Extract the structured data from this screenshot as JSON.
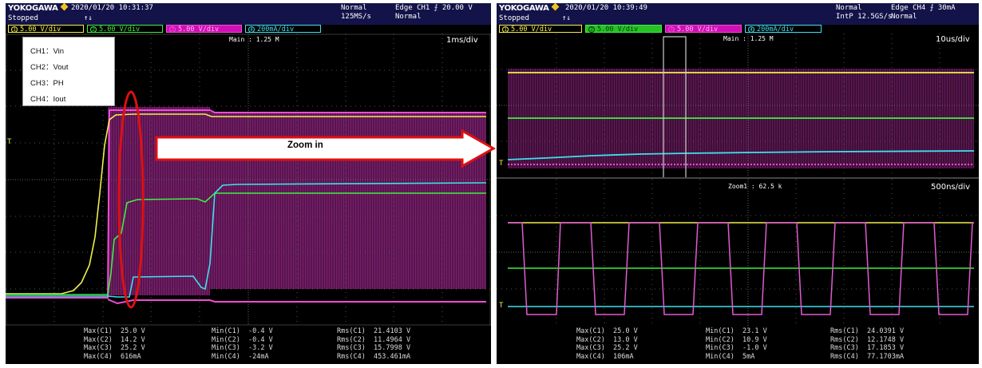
{
  "left": {
    "brand": "YOKOGAWA",
    "datetime": "2020/01/20 10:31:37",
    "status": "Stopped",
    "trigger_status_marker": "↑↓",
    "acq_mode": "Normal",
    "sample_rate": "125MS/s",
    "trigger_type": "Edge CH1 ⨍ 20.00 V",
    "trigger_mode": "Normal",
    "channels": [
      {
        "num": "1",
        "scale": "5.00 V/div"
      },
      {
        "num": "2",
        "scale": "5.00 V/div"
      },
      {
        "num": "3",
        "scale": "5.00 V/div"
      },
      {
        "num": "4",
        "scale": "200mA/div"
      }
    ],
    "main_label": "Main : 1.25 M",
    "timebase": "1ms/div",
    "legend": [
      "CH1：Vin",
      "CH2：Vout",
      "CH3：PH",
      "CH4：Iout"
    ],
    "measurements": {
      "max": "Max(C1)  25.0 V\nMax(C2)  14.2 V\nMax(C3)  25.2 V\nMax(C4)  616mA",
      "min": "Min(C1)  -0.4 V\nMin(C2)  -0.4 V\nMin(C3)  -3.2 V\nMin(C4)  -24mA",
      "rms": "Rms(C1)  21.4103 V\nRms(C2)  11.4964 V\nRms(C3)  15.7998 V\nRms(C4)  453.461mA"
    }
  },
  "right": {
    "brand": "YOKOGAWA",
    "datetime": "2020/01/20 10:39:49",
    "status": "Stopped",
    "trigger_status_marker": "↑↓",
    "acq_mode": "Normal",
    "sample_rate": "IntP 12.5GS/s",
    "trigger_type": "Edge CH4 ⨍ 30mA",
    "trigger_mode": "Normal",
    "channels": [
      {
        "num": "1",
        "scale": "5.00 V/div"
      },
      {
        "num": "2",
        "scale": "5.00 V/div"
      },
      {
        "num": "3",
        "scale": "5.00 V/div"
      },
      {
        "num": "4",
        "scale": "200mA/div"
      }
    ],
    "main_label": "Main : 1.25 M",
    "timebase_top": "10us/div",
    "zoom_label": "Zoom1 : 62.5 k",
    "timebase_bottom": "500ns/div",
    "measurements": {
      "max": "Max(C1)  25.0 V\nMax(C2)  13.0 V\nMax(C3)  25.2 V\nMax(C4)  106mA",
      "min": "Min(C1)  23.1 V\nMin(C2)  10.9 V\nMin(C3)  -1.0 V\nMin(C4)  5mA",
      "rms": "Rms(C1)  24.0391 V\nRms(C2)  12.1748 V\nRms(C3)  17.1853 V\nRms(C4)  77.1703mA"
    }
  },
  "annotation": {
    "zoom_label": "Zoom in",
    "trigger_level_marker": "T"
  },
  "colors": {
    "ch1": "#f2ee4a",
    "ch2": "#3ef03e",
    "ch3": "#f24bd6",
    "ch4": "#3ee0ee",
    "annotation_red": "#e01010"
  }
}
